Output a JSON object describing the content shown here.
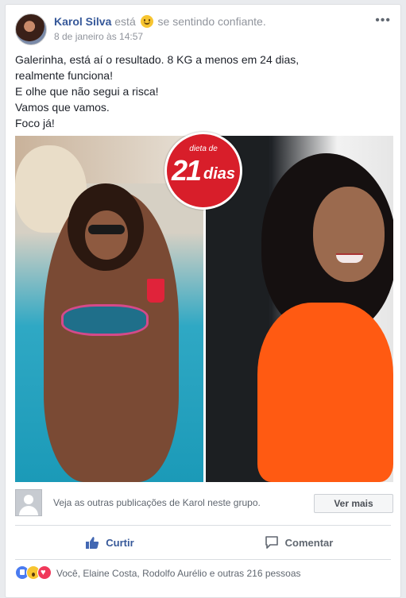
{
  "post": {
    "author_name": "Karol Silva",
    "feeling_prefix": "está",
    "feeling_icon": "smiling-face-icon",
    "feeling_text": "se sentindo confiante.",
    "timestamp": "8 de janeiro às 14:57",
    "more_icon": "•••",
    "text_lines": [
      "Galerinha, está aí o resultado. 8 KG a menos em 24 dias,",
      "realmente funciona!",
      "E olhe que não segui a risca!",
      "Vamos que vamos.",
      "Foco já!"
    ]
  },
  "badge": {
    "small_text": "dieta de",
    "number": "21",
    "word": "dias",
    "color": "#d81e2a"
  },
  "other_posts": {
    "text": "Veja as outras publicações de Karol neste grupo.",
    "button_label": "Ver mais"
  },
  "actions": {
    "like_label": "Curtir",
    "comment_label": "Comentar",
    "like_color": "#365899"
  },
  "reactions": {
    "icons": [
      "like-reaction-icon",
      "wow-reaction-icon",
      "love-reaction-icon"
    ],
    "text": "Você, Elaine Costa, Rodolfo Aurélio e outras 216 pessoas"
  }
}
